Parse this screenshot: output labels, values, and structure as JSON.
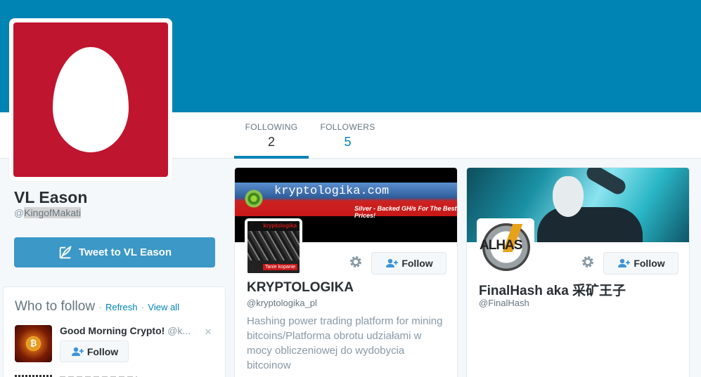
{
  "profile": {
    "name": "VL Eason",
    "handle_prefix": "@",
    "handle": "KingofMakati",
    "avatar_color": "#c0152f",
    "tweet_button_label": "Tweet to VL Eason"
  },
  "nav": {
    "following_label": "FOLLOWING",
    "following_count": "2",
    "followers_label": "FOLLOWERS",
    "followers_count": "5"
  },
  "who_to_follow": {
    "title": "Who to follow",
    "separator": "·",
    "refresh": "Refresh",
    "view_all": "View all",
    "suggestion": {
      "name": "Good Morning Crypto!",
      "handle": "@k...",
      "follow_label": "Follow",
      "close": "×",
      "avatar_icon": "bitcoin-icon",
      "avatar_glyph": "₿"
    }
  },
  "cards": [
    {
      "name": "KRYPTOLOGIKA",
      "handle": "@kryptologika_pl",
      "bio": "Hashing power trading platform for mining bitcoins/Platforma obrotu udziałami w mocy obliczeniowej do wydobycia bitcoinow",
      "follow_label": "Follow",
      "banner_brand": "kryptologika.com",
      "banner_tagline": "Silver - Backed GH/s For The Best Prices!",
      "avatar_top_text": "kryptologika",
      "avatar_badge": "Tanie kopanie"
    },
    {
      "name": "FinalHash aka 采矿王子",
      "handle": "@FinalHash",
      "bio": "",
      "follow_label": "Follow",
      "avatar_text": "ALHAS"
    }
  ],
  "colors": {
    "header": "#0084b4",
    "accent": "#0084b4",
    "tweet_button": "#3b98c7"
  }
}
